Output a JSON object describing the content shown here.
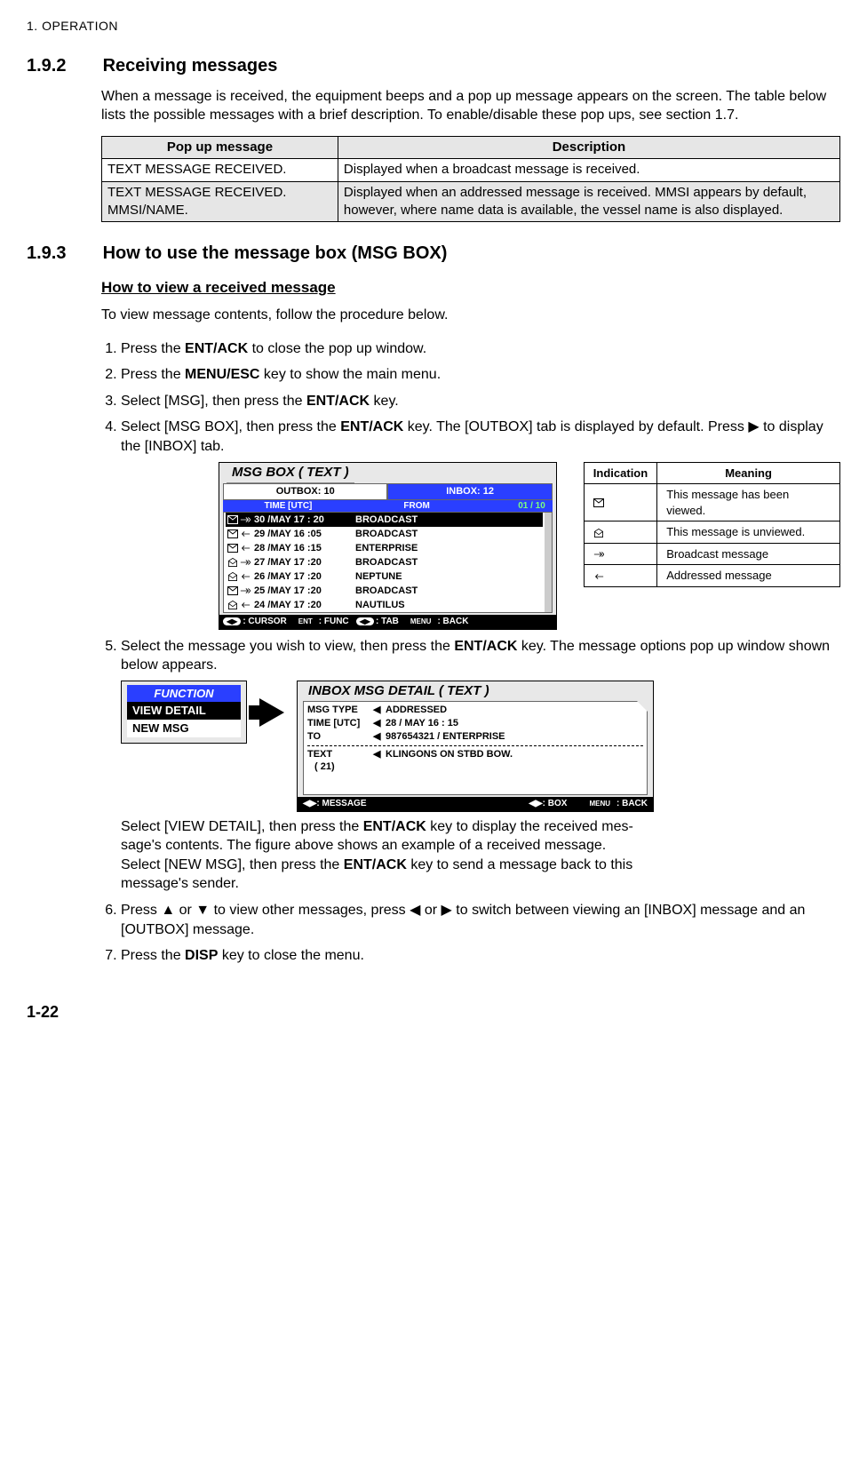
{
  "header": "1.  OPERATION",
  "sec192": {
    "num": "1.9.2",
    "title": "Receiving messages"
  },
  "intro192": "When a message is received, the equipment beeps and a pop up message appears on the screen. The table below lists the possible messages with a brief description. To enable/disable these pop ups, see section 1.7.",
  "popup_table": {
    "headers": [
      "Pop up message",
      "Description"
    ],
    "rows": [
      [
        "TEXT MESSAGE RECEIVED.",
        "Displayed when a broadcast message is received."
      ],
      [
        "TEXT MESSAGE RECEIVED. MMSI/NAME.",
        "Displayed when an addressed message is received. MMSI appears by default, however, where name data is available, the vessel name is also displayed."
      ]
    ]
  },
  "sec193": {
    "num": "1.9.3",
    "title": "How to use the message box (MSG BOX)"
  },
  "sub_view": "How to view a received message",
  "view_intro": "To view message contents, follow the procedure below.",
  "steps": {
    "s1a": "Press the ",
    "s1b": "ENT/ACK",
    "s1c": " to close the pop up window.",
    "s2a": "Press the ",
    "s2b": "MENU/ESC",
    "s2c": " key to show the main menu.",
    "s3a": "Select [MSG], then press the ",
    "s3b": "ENT/ACK",
    "s3c": " key.",
    "s4a": "Select [MSG BOX], then press the ",
    "s4b": "ENT/ACK",
    "s4c": " key. The [OUTBOX] tab is displayed by default. Press ▶ to display the [INBOX] tab.",
    "s5a": "Select the message you wish to view, then press the ",
    "s5b": "ENT/ACK",
    "s5c": " key. The message options pop up window shown below appears.",
    "s6": "Press ▲ or ▼ to view other messages, press ◀ or ▶ to switch between viewing an [INBOX] message and an [OUTBOX] message.",
    "s7a": "Press the ",
    "s7b": "DISP",
    "s7c": " key to close the menu."
  },
  "msgbox": {
    "title": "MSG BOX ( TEXT )",
    "outbox_tab": "OUTBOX: 10",
    "inbox_tab": "INBOX: 12",
    "col_time": "TIME [UTC]",
    "col_from": "FROM",
    "col_pg": "01 / 10",
    "rows": [
      {
        "viewed": "closed",
        "dir": "bcast",
        "dt": "30 /MAY   17 : 20",
        "from": "BROADCAST",
        "sel": true
      },
      {
        "viewed": "closed",
        "dir": "addr",
        "dt": "29 /MAY   16 :05",
        "from": "BROADCAST"
      },
      {
        "viewed": "closed",
        "dir": "addr",
        "dt": "28 /MAY   16 :15",
        "from": "ENTERPRISE"
      },
      {
        "viewed": "open",
        "dir": "bcast",
        "dt": "27 /MAY   17 :20",
        "from": "BROADCAST"
      },
      {
        "viewed": "open",
        "dir": "addr",
        "dt": "26 /MAY   17 :20",
        "from": "NEPTUNE"
      },
      {
        "viewed": "closed",
        "dir": "bcast",
        "dt": "25 /MAY   17 :20",
        "from": "BROADCAST"
      },
      {
        "viewed": "open",
        "dir": "addr",
        "dt": "24 /MAY   17 :20",
        "from": "NAUTILUS"
      }
    ],
    "footer": {
      "cursor": ": CURSOR",
      "func": ": FUNC",
      "tab": ": TAB",
      "back": ": BACK",
      "ent": "ENT",
      "menu": "MENU"
    }
  },
  "ind_table": {
    "h1": "Indication",
    "h2": "Meaning",
    "rows": [
      {
        "icon": "closed",
        "text": "This message has been viewed."
      },
      {
        "icon": "open",
        "text": "This message is unviewed."
      },
      {
        "icon": "bcast",
        "text": "Broadcast message"
      },
      {
        "icon": "addr",
        "text": "Addressed message"
      }
    ]
  },
  "func": {
    "title": "FUNCTION",
    "item1": "VIEW DETAIL",
    "item2": "NEW MSG"
  },
  "detail": {
    "title": "INBOX MSG DETAIL ( TEXT )",
    "type_lab": "MSG  TYPE",
    "type_val": "ADDRESSED",
    "time_lab": "TIME [UTC]",
    "time_val": "28 / MAY    16 : 15",
    "to_lab": "TO",
    "to_val": "987654321 / ENTERPRISE",
    "text_lab": "TEXT",
    "text_idx": "(  21)",
    "text_val": "KLINGONS ON STBD BOW.",
    "f_msg": ": MESSAGE",
    "f_box": ": BOX",
    "f_back": ": BACK",
    "menu": "MENU"
  },
  "after5": {
    "l1a": "Select [VIEW DETAIL], then press the ",
    "l1b": "ENT/ACK",
    "l1c": " key to display the received mes-",
    "l2": "sage's contents. The figure above shows an example of a received message.",
    "l3a": "Select [NEW MSG], then press the ",
    "l3b": "ENT/ACK",
    "l3c": " key to send a message back to this",
    "l4": "message's sender."
  },
  "pagenum": "1-22"
}
